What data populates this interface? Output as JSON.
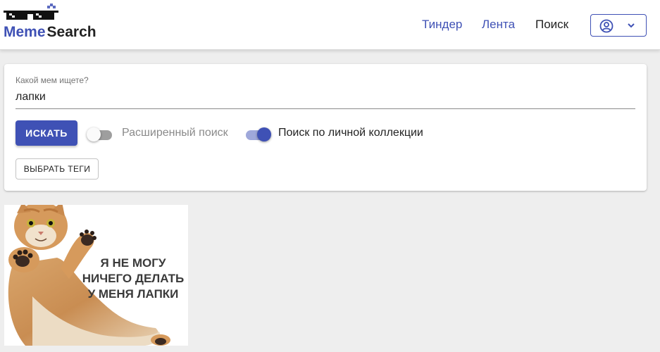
{
  "header": {
    "logo": {
      "part1": "Meme",
      "part2": "Search"
    },
    "nav": {
      "tinder": "Тиндер",
      "feed": "Лента",
      "search": "Поиск"
    },
    "account": {
      "icon": "account-circle-icon",
      "chevron": "chevron-down-icon"
    }
  },
  "search": {
    "label": "Какой мем ищете?",
    "value": "лапки",
    "button": "ИСКАТЬ",
    "advanced": {
      "label": "Расширенный поиск",
      "enabled": false
    },
    "collection": {
      "label": "Поиск по личной коллекции",
      "enabled": true
    },
    "tags_button": "ВЫБРАТЬ ТЕГИ"
  },
  "results": [
    {
      "caption": [
        "Я НЕ МОГУ",
        "НИЧЕГО ДЕЛАТЬ",
        "У МЕНЯ ЛАПКИ"
      ]
    }
  ],
  "colors": {
    "accent": "#3f51b5",
    "accent_light": "#9fa8da",
    "background": "#eeeeee"
  }
}
